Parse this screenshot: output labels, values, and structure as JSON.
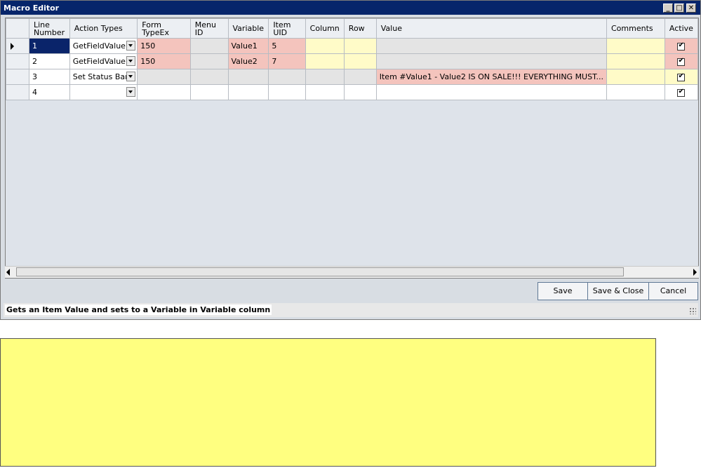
{
  "window": {
    "title": "Macro Editor",
    "min": "_",
    "max": "□",
    "close": "✕"
  },
  "grid": {
    "headers": [
      "",
      "Line Number",
      "Action Types",
      "Form TypeEx",
      "Menu ID",
      "Variable",
      "Item UID",
      "Column",
      "Row",
      "Value",
      "Comments",
      "Active"
    ],
    "rows": [
      {
        "line": "1",
        "action": "GetFieldValue",
        "form": "150",
        "menu": "",
        "variable": "Value1",
        "item": "5",
        "column": "",
        "row": "",
        "value": "",
        "comments": "",
        "active": true
      },
      {
        "line": "2",
        "action": "GetFieldValue",
        "form": "150",
        "menu": "",
        "variable": "Value2",
        "item": "7",
        "column": "",
        "row": "",
        "value": "",
        "comments": "",
        "active": true
      },
      {
        "line": "3",
        "action": "Set Status Bar",
        "form": "",
        "menu": "",
        "variable": "",
        "item": "",
        "column": "",
        "row": "",
        "value": "Item #Value1 - Value2 IS ON SALE!!! EVERYTHING MUST...",
        "comments": "",
        "active": true
      },
      {
        "line": "4",
        "action": "",
        "form": "",
        "menu": "",
        "variable": "",
        "item": "",
        "column": "",
        "row": "",
        "value": "",
        "comments": "",
        "active": true
      }
    ]
  },
  "buttons": {
    "save": "Save",
    "save_close": "Save & Close",
    "cancel": "Cancel"
  },
  "status": {
    "text": "Gets an Item Value and sets to a Variable in Variable column"
  },
  "colors": {
    "title_bar": "#06256b",
    "pink_cell": "#f4c4bd",
    "yellow_cell": "#fffbc8",
    "panel": "#ffff80",
    "selection": "#0a246a"
  }
}
